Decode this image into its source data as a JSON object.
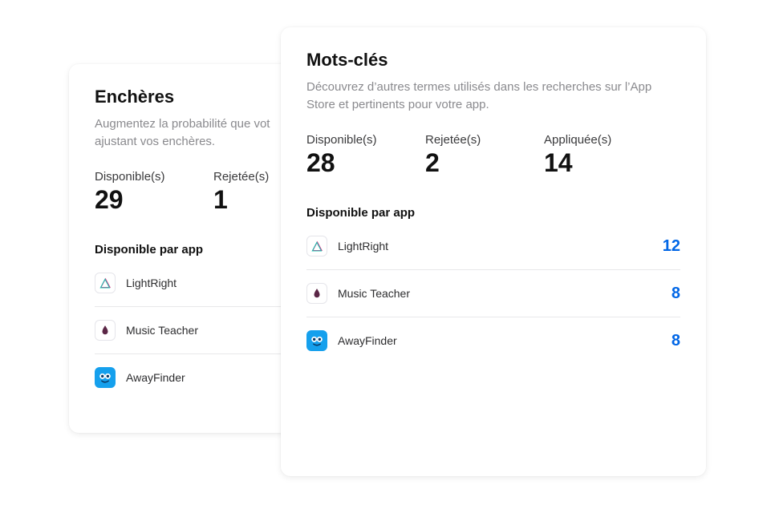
{
  "encheres": {
    "title": "Enchères",
    "description": "Augmentez la probabilité que votre annonce soit diffusée en ajustant vos enchères.",
    "description_truncated_line1": "Augmentez la probabilité que vot",
    "description_truncated_line2": "ajustant vos enchères.",
    "stats": [
      {
        "label": "Disponible(s)",
        "value": "29"
      },
      {
        "label": "Rejetée(s)",
        "value": "1"
      }
    ],
    "section_header": "Disponible par app",
    "apps": [
      {
        "name": "LightRight",
        "icon": "lightright"
      },
      {
        "name": "Music Teacher",
        "icon": "musicteacher"
      },
      {
        "name": "AwayFinder",
        "icon": "awayfinder"
      }
    ]
  },
  "motscles": {
    "title": "Mots-clés",
    "description": "Découvrez d’autres termes utilisés dans les recherches sur l’App Store et pertinents pour votre app.",
    "stats": [
      {
        "label": "Disponible(s)",
        "value": "28"
      },
      {
        "label": "Rejetée(s)",
        "value": "2"
      },
      {
        "label": "Appliquée(s)",
        "value": "14"
      }
    ],
    "section_header": "Disponible par app",
    "apps": [
      {
        "name": "LightRight",
        "icon": "lightright",
        "count": "12"
      },
      {
        "name": "Music Teacher",
        "icon": "musicteacher",
        "count": "8"
      },
      {
        "name": "AwayFinder",
        "icon": "awayfinder",
        "count": "8"
      }
    ]
  }
}
